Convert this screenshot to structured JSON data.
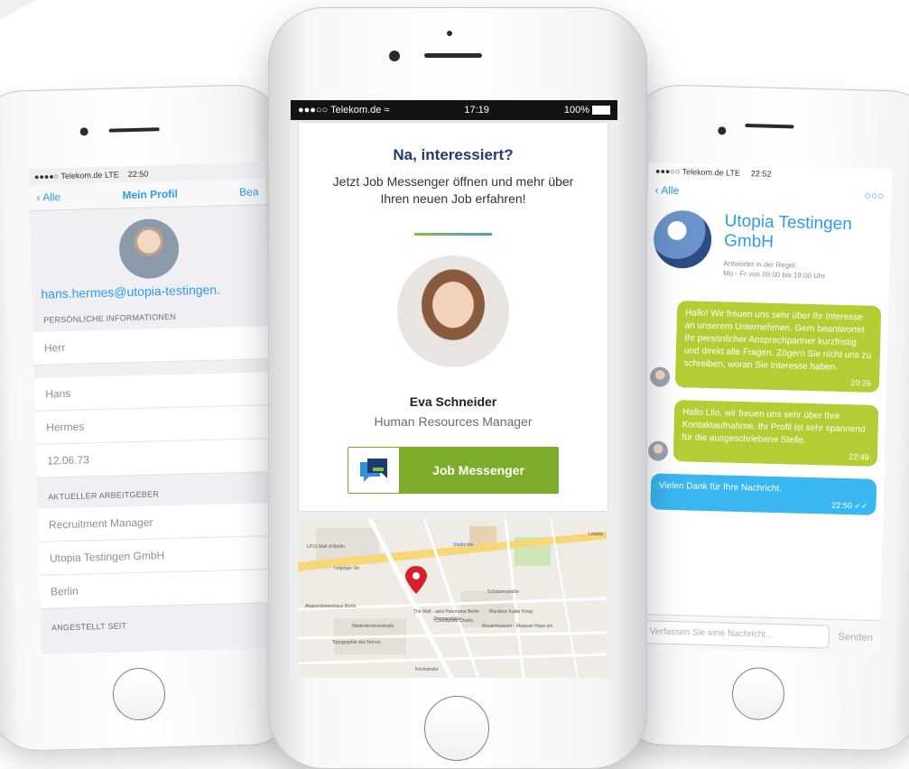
{
  "left_phone": {
    "status": {
      "carrier": "●●●●○ Telekom.de LTE",
      "time": "22:50"
    },
    "nav": {
      "back": "Alle",
      "title": "Mein Profil",
      "action": "Bea"
    },
    "email": "hans.hermes@utopia-testingen.",
    "personal_header": "PERSÖNLICHE INFORMATIONEN",
    "salutation": "Herr",
    "first_name": "Hans",
    "last_name": "Hermes",
    "birthdate": "12.06.73",
    "employer_header": "AKTUELLER ARBEITGEBER",
    "position": "Recruitment Manager",
    "company": "Utopia Testingen GmbH",
    "city": "Berlin",
    "employed_since_header": "ANGESTELLT SEIT"
  },
  "center_phone": {
    "status": {
      "carrier": "●●●○○ Telekom.de",
      "wifi_icon": "wifi-icon",
      "time": "17:19",
      "battery": "100%"
    },
    "card": {
      "title": "Na, interessiert?",
      "text": "Jetzt Job Messenger öffnen und mehr über Ihren neuen Job erfahren!",
      "person_name": "Eva Schneider",
      "person_role": "Human Resources Manager",
      "button_label": "Job Messenger"
    },
    "map": {
      "pin_icon": "map-pin-icon",
      "labels": [
        "LP12 Mall of Berlin",
        "Leipziger Str.",
        "Stadtmitte",
        "Abgeordnetenhaus Berlin",
        "Topographie des Terrors",
        "The Wall - asisi Panorama Berlin",
        "Checkpoint Charlie",
        "Blackbox Kalter Krieg",
        "Mauermuseum - Museum Haus am",
        "Kochstraße",
        "Zimmerstraße",
        "Niederkirchnerstraße",
        "Schützenstraße",
        "Leipzig"
      ]
    },
    "accent_green": "#7dab2a",
    "title_color": "#1f3b73"
  },
  "right_phone": {
    "status": {
      "carrier": "●●●○○ Telekom.de LTE",
      "time": "22:52"
    },
    "nav": {
      "back": "Alle",
      "more": "○○○"
    },
    "company_name": "Utopia Testingen GmbH",
    "reply_note": "Antwortet in der Regel:",
    "hours": "Mo - Fr von 09:00 bis 19:00 Uhr",
    "messages": [
      {
        "text": "Hallo! Wir freuen uns sehr über Ihr Interesse an unserem Unternehmen. Gern beantwortet Ihr persönlicher Ansprechpartner kurzfristig und direkt alle Fragen. Zögern Sie nicht uns zu schreiben, woran Sie Interesse haben.",
        "time": "20:26"
      },
      {
        "text": "Hallo Lilo, wir freuen uns sehr über Ihre Kontaktaufnahme. Ihr Profil ist sehr spannend für die ausgeschriebene Stelle.",
        "time": "22:49"
      },
      {
        "text": "Vielen Dank für Ihre Nachricht.",
        "time": "22:50 ✓✓"
      }
    ],
    "composer_placeholder": "Verfassen Sie eine Nachricht...",
    "send_label": "Senden"
  }
}
